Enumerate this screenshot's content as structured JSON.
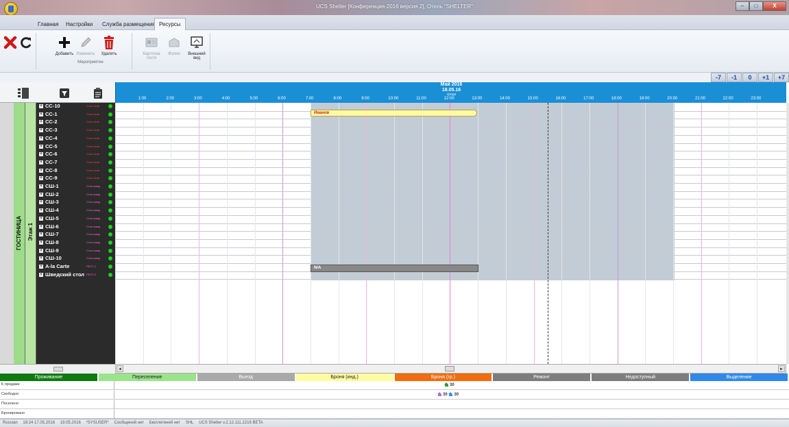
{
  "window": {
    "title": "UCS Shelter [Конференция-2016 версия 2], Отель \"SHELTER\"",
    "buttons": [
      "–",
      "□",
      "X"
    ]
  },
  "tabs": [
    "Главная",
    "Настройки",
    "Служба размещения",
    "Ресурсы"
  ],
  "active_tab": 3,
  "ribbon": {
    "add": "Добавить",
    "edit": "Изменить",
    "delete": "Удалить",
    "guest_card": "Карточка гостя",
    "folio": "Фолио",
    "appearance": "Внешний вид",
    "group_label": "Мероприятие"
  },
  "zoom_buttons": [
    "-7",
    "-1",
    "0",
    "+1",
    "+7"
  ],
  "timeline": {
    "month": "Май 2016",
    "date": "18.05.16",
    "weekday": "среда",
    "hours": [
      "1:00",
      "2:00",
      "3:00",
      "4:00",
      "5:00",
      "6:00",
      "7:00",
      "8:00",
      "9:00",
      "10:00",
      "11:00",
      "12:00",
      "13:00",
      "14:00",
      "15:00",
      "16:00",
      "17:00",
      "18:00",
      "19:00",
      "20:00",
      "21:00",
      "22:00",
      "23:00"
    ]
  },
  "left": {
    "hotel_label": "ГОСТИНИЦА",
    "floor_label": "Этаж 1"
  },
  "rooms": [
    {
      "name": "CC-10",
      "tag": "Стол сале",
      "tag_color": "#ff4444"
    },
    {
      "name": "CC-1",
      "tag": "Стол сале",
      "tag_color": "#ff4444"
    },
    {
      "name": "CC-2",
      "tag": "Стол сале",
      "tag_color": "#ff4444"
    },
    {
      "name": "CC-3",
      "tag": "Стол сале",
      "tag_color": "#ff4444"
    },
    {
      "name": "CC-4",
      "tag": "Стол сале",
      "tag_color": "#ff4444"
    },
    {
      "name": "CC-5",
      "tag": "Стол сале",
      "tag_color": "#ff4444"
    },
    {
      "name": "CC-6",
      "tag": "Стол сале",
      "tag_color": "#ff4444"
    },
    {
      "name": "CC-7",
      "tag": "Стол сале",
      "tag_color": "#ff4444"
    },
    {
      "name": "CC-8",
      "tag": "Стол сале",
      "tag_color": "#ff4444"
    },
    {
      "name": "CC-9",
      "tag": "Стол сале",
      "tag_color": "#ff4444"
    },
    {
      "name": "СШ-1",
      "tag": "Стол швед",
      "tag_color": "#ff66cc"
    },
    {
      "name": "СШ-2",
      "tag": "Стол швед",
      "tag_color": "#ff66cc"
    },
    {
      "name": "СШ-3",
      "tag": "Стол швед",
      "tag_color": "#ff66cc"
    },
    {
      "name": "СШ-4",
      "tag": "Стол швед",
      "tag_color": "#ff66cc"
    },
    {
      "name": "СШ-5",
      "tag": "Стол швед",
      "tag_color": "#ff66cc"
    },
    {
      "name": "СШ-6",
      "tag": "Стол швед",
      "tag_color": "#ff66cc"
    },
    {
      "name": "СШ-7",
      "tag": "Стол швед",
      "tag_color": "#ff66cc"
    },
    {
      "name": "СШ-8",
      "tag": "Стол швед",
      "tag_color": "#ff66cc"
    },
    {
      "name": "СШ-9",
      "tag": "Стол швед",
      "tag_color": "#ff66cc"
    },
    {
      "name": "СШ-10",
      "tag": "Стол швед",
      "tag_color": "#ff66cc"
    },
    {
      "name": "A-la Carte",
      "tag": "РЕСТ-1",
      "tag_color": "#ff66cc"
    },
    {
      "name": "Шведский стол",
      "tag": "РЕСТ-2",
      "tag_color": "#ff66cc"
    }
  ],
  "bookings": {
    "ivanov": "Иванов",
    "na": "N/A"
  },
  "legend": [
    {
      "label": "Проживание",
      "color": "#0f7a12"
    },
    {
      "label": "Переселение",
      "color": "#9be38c"
    },
    {
      "label": "Выезд",
      "color": "#a9a9a9"
    },
    {
      "label": "Броня (инд.)",
      "color": "#fffba0"
    },
    {
      "label": "Броня (гр.)",
      "color": "#ef6d0e"
    },
    {
      "label": "Ремонт",
      "color": "#7d7d7d"
    },
    {
      "label": "Недоступный",
      "color": "#7d7d7d"
    },
    {
      "label": "Выделение",
      "color": "#2e88ea"
    }
  ],
  "stats": {
    "for_sale": {
      "label": "К продаже",
      "value": "30"
    },
    "free": {
      "label": "Свободно",
      "value_a": "30",
      "value_b": "30"
    },
    "occupied": {
      "label": "Поселено"
    },
    "booked": {
      "label": "Бронировано"
    }
  },
  "status": {
    "language": "Russian",
    "datetime": "18:24 17.05.2016",
    "date": "19.05.2016",
    "user": "*SYSUSER*",
    "messages": "Сообщений нет",
    "bulletins": "Бюллетеней нет",
    "hotel": "SHL",
    "version": "UCS Shelter v.2.12.111.2216 BETA"
  }
}
